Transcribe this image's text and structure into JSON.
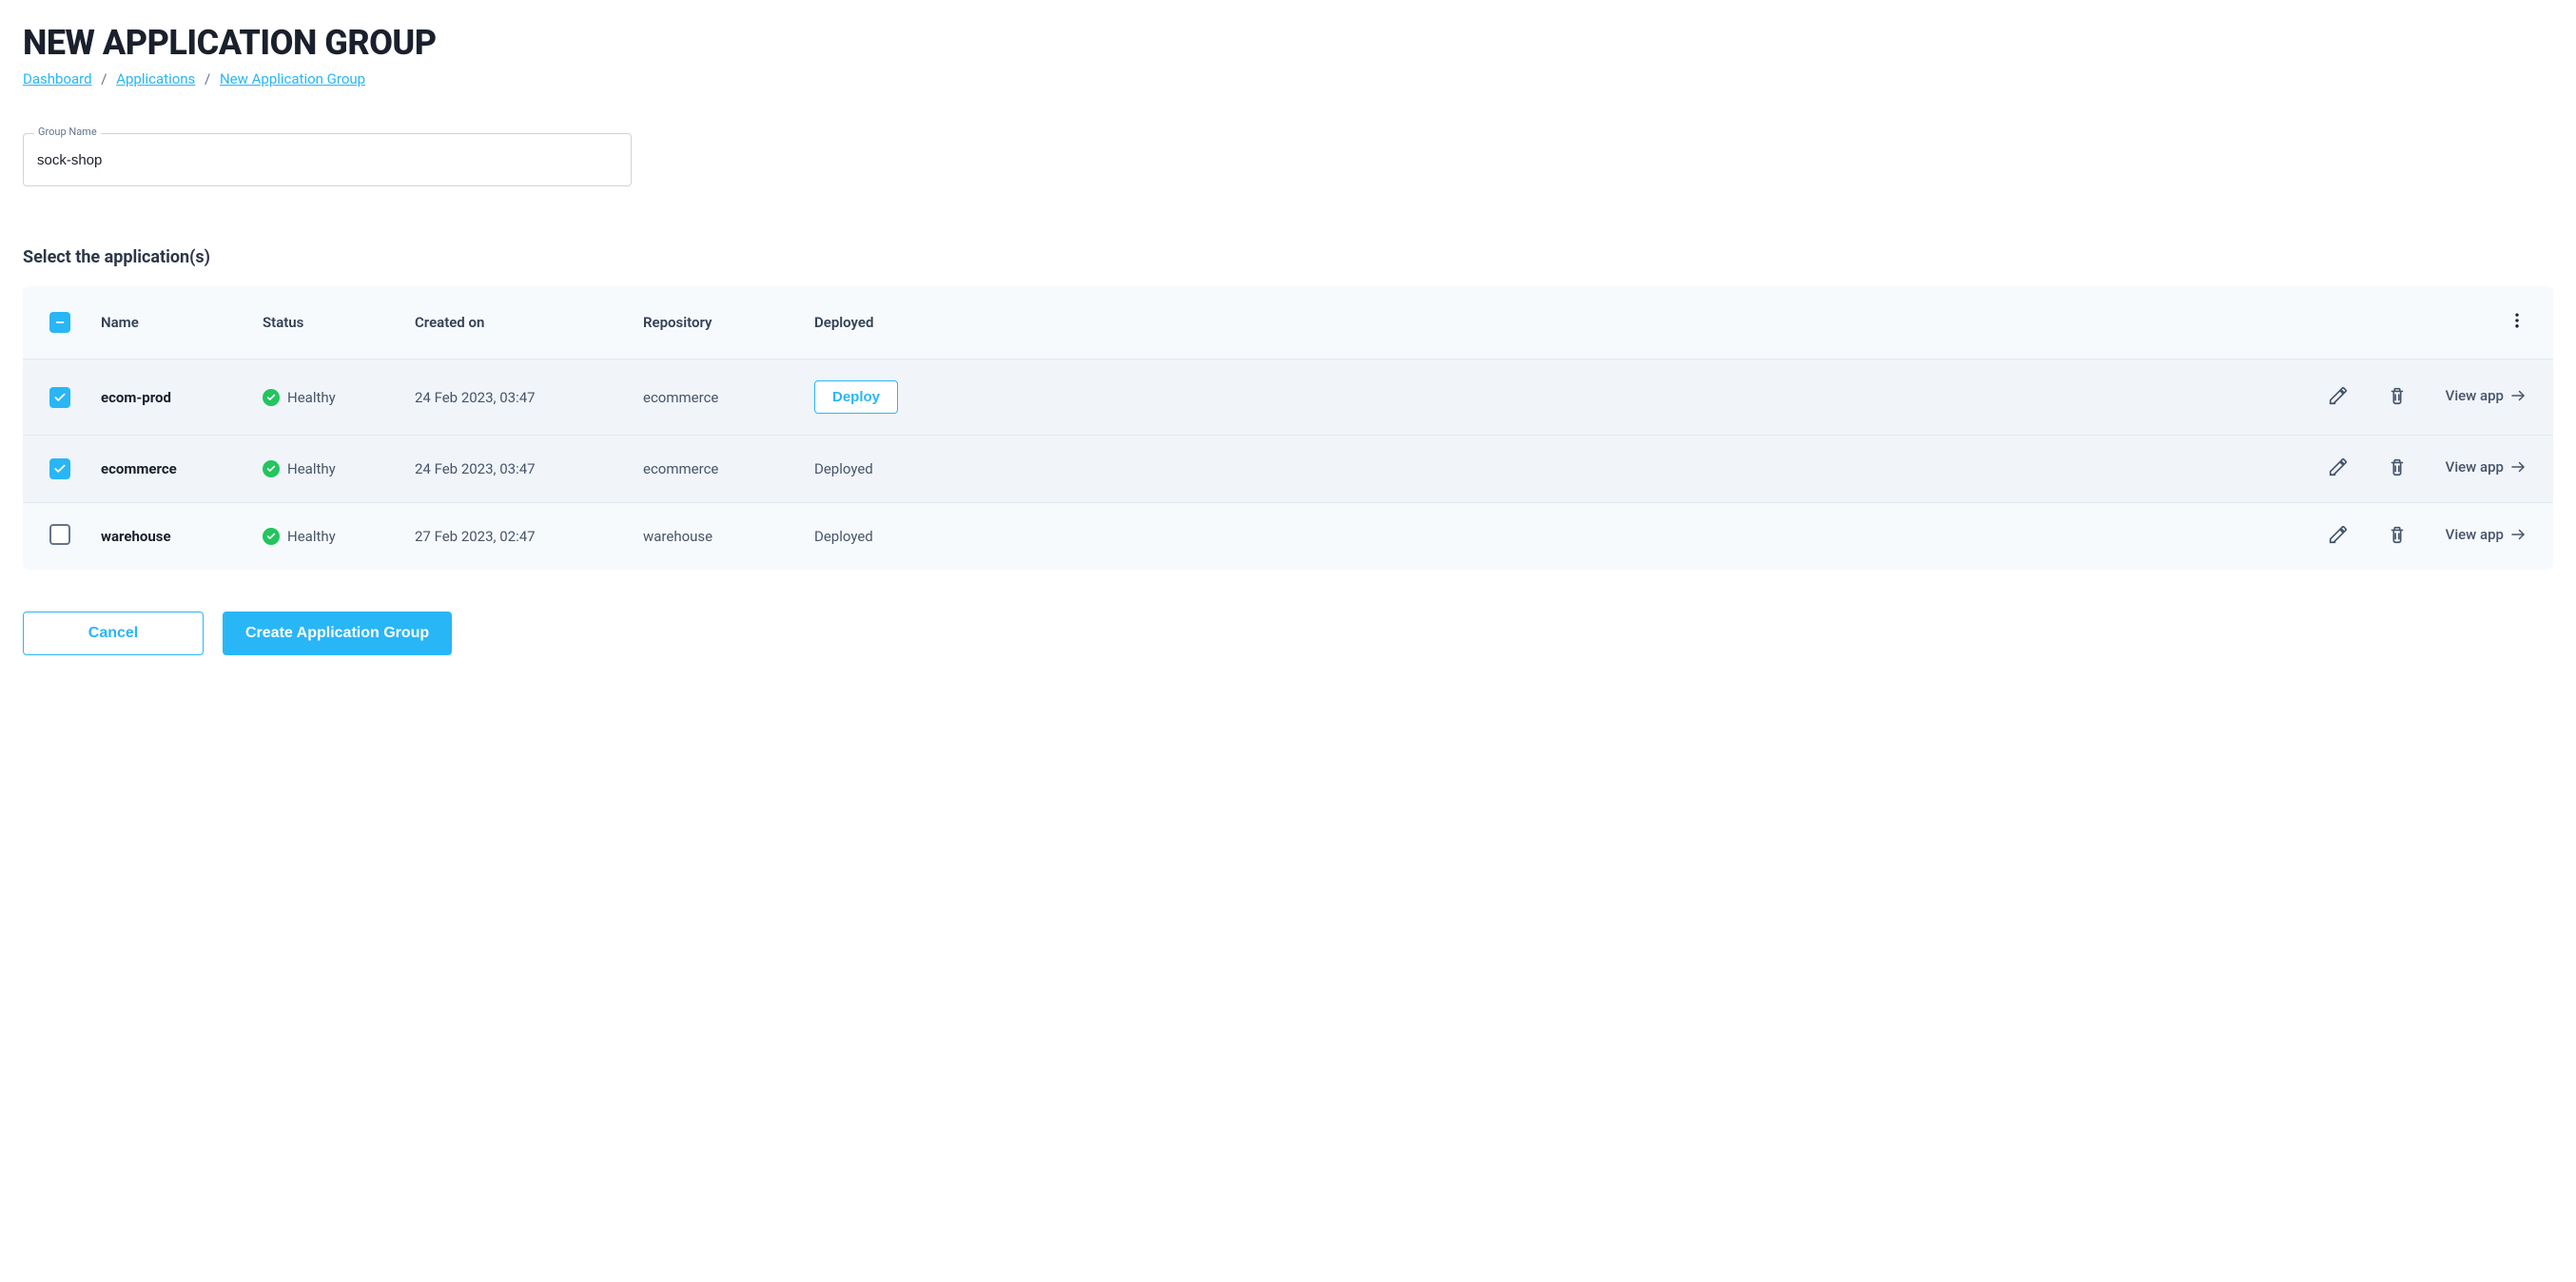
{
  "page_title": "NEW APPLICATION GROUP",
  "breadcrumb": {
    "items": [
      "Dashboard",
      "Applications",
      "New Application Group"
    ]
  },
  "form": {
    "group_name_label": "Group Name",
    "group_name_value": "sock-shop"
  },
  "section_heading": "Select the application(s)",
  "table": {
    "headers": {
      "name": "Name",
      "status": "Status",
      "created": "Created on",
      "repository": "Repository",
      "deployed": "Deployed"
    },
    "header_checkbox_state": "indeterminate",
    "rows": [
      {
        "checked": true,
        "name": "ecom-prod",
        "status": "Healthy",
        "created": "24 Feb 2023, 03:47",
        "repository": "ecommerce",
        "deployed_label": "Deploy",
        "deployed_mode": "button",
        "view_label": "View app"
      },
      {
        "checked": true,
        "name": "ecommerce",
        "status": "Healthy",
        "created": "24 Feb 2023, 03:47",
        "repository": "ecommerce",
        "deployed_label": "Deployed",
        "deployed_mode": "text",
        "view_label": "View app"
      },
      {
        "checked": false,
        "name": "warehouse",
        "status": "Healthy",
        "created": "27 Feb 2023, 02:47",
        "repository": "warehouse",
        "deployed_label": "Deployed",
        "deployed_mode": "text",
        "view_label": "View app"
      }
    ]
  },
  "actions": {
    "cancel": "Cancel",
    "create": "Create Application Group"
  },
  "colors": {
    "accent": "#29b6f6",
    "success": "#22c55e"
  }
}
